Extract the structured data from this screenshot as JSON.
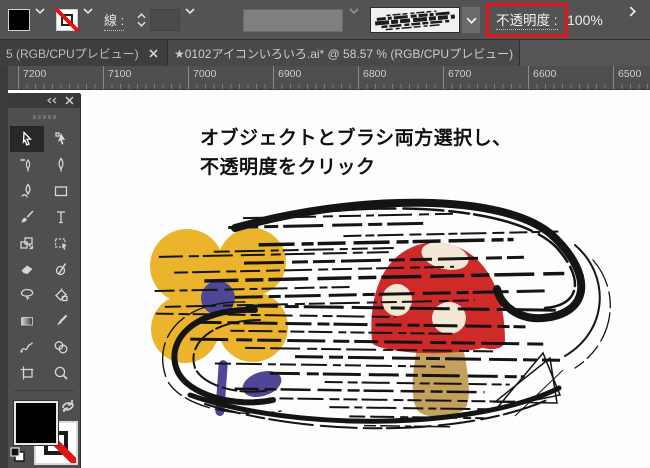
{
  "theme": {
    "highlight": "#e8121d",
    "flower": "#ecb42c",
    "flower_center": "#4f4796",
    "cap": "#ce2a2a",
    "spot": "#f3e8d6",
    "stem": "#c3a05c",
    "ink": "#141414"
  },
  "options_bar": {
    "fill_swatch_color": "#000000",
    "stroke_swatch": "none",
    "stroke_label": "線 :",
    "stroke_weight_value": "",
    "brush_name": "charcoal-scratch-brush",
    "opacity_label": "不透明度 :",
    "opacity_value": "100%"
  },
  "tabs": [
    {
      "label": "5 (RGB/CPUプレビュー)",
      "active": false
    },
    {
      "label": "★0102アイコンいろいろ.ai* @ 58.57 % (RGB/CPUプレビュー)",
      "active": true
    }
  ],
  "ruler": {
    "labels": [
      "7200",
      "7100",
      "7000",
      "6900",
      "6800",
      "6700",
      "6600",
      "6500"
    ]
  },
  "tools_panel": {
    "active_tool": "selection",
    "tools": [
      "selection",
      "direct-selection",
      "delete-anchor-point",
      "pen",
      "curvature",
      "rectangle",
      "paintbrush",
      "type",
      "scale",
      "group-selection",
      "eraser",
      "shape-builder",
      "lasso",
      "live-paint-bucket",
      "gradient",
      "eyedropper",
      "puppet-warp",
      "symbol-sprayer",
      "artboard",
      "zoom"
    ],
    "fill_color": "#000000",
    "stroke_color": "none"
  },
  "canvas": {
    "caption_line1": "オブジェクトとブラシ両方選択し、",
    "caption_line2": "不透明度をクリック"
  }
}
